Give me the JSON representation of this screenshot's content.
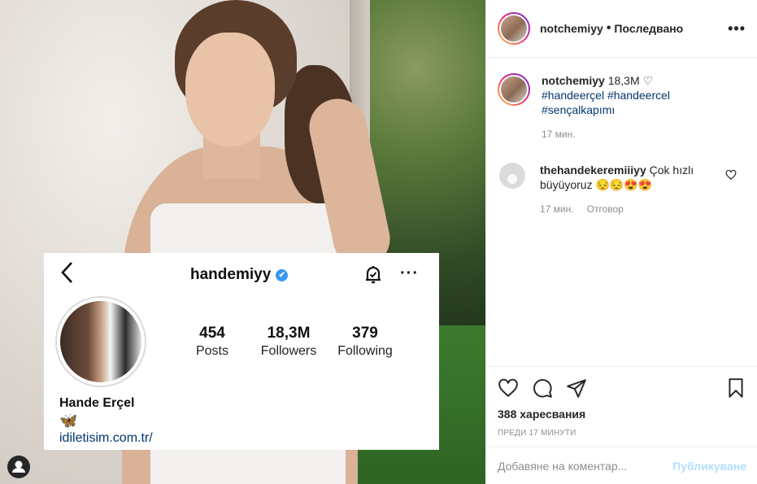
{
  "photo": {
    "profile_card": {
      "back_icon": "chevron-left-icon",
      "username": "handemiyy",
      "verified_mark": "✔",
      "bell_icon": "notification-bell-icon",
      "more_icon": "more-horizontal-icon",
      "stats": [
        {
          "num": "454",
          "label": "Posts"
        },
        {
          "num": "18,3M",
          "label": "Followers"
        },
        {
          "num": "379",
          "label": "Following"
        }
      ],
      "full_name": "Hande Erçel",
      "butterfly": "🦋",
      "link": "idiletisim.com.tr/"
    }
  },
  "header": {
    "username": "notchemiyy",
    "separator": "•",
    "follow_label": "Последвано",
    "menu": "•••"
  },
  "caption": {
    "username": "notchemiyy",
    "text": "18,3M ♡",
    "tags": [
      "#handeerçel #handeercel",
      "#sençalkapımı"
    ],
    "time": "17 мин."
  },
  "comment": {
    "username": "thehandekeremiiiyy",
    "text": "Çok hızlı büyüyoruz 😔😔😍😍",
    "time": "17 мин.",
    "reply": "Отговор"
  },
  "actions": {
    "likes": "388 харесвания",
    "posted_ago": "преди 17 минути"
  },
  "add_comment": {
    "placeholder": "Добавяне на коментар...",
    "post_label": "Публикуване"
  },
  "colors": {
    "link": "#00376b",
    "verified": "#3897f0",
    "muted": "#8e8e8e",
    "post_disabled": "#b2dffc"
  }
}
